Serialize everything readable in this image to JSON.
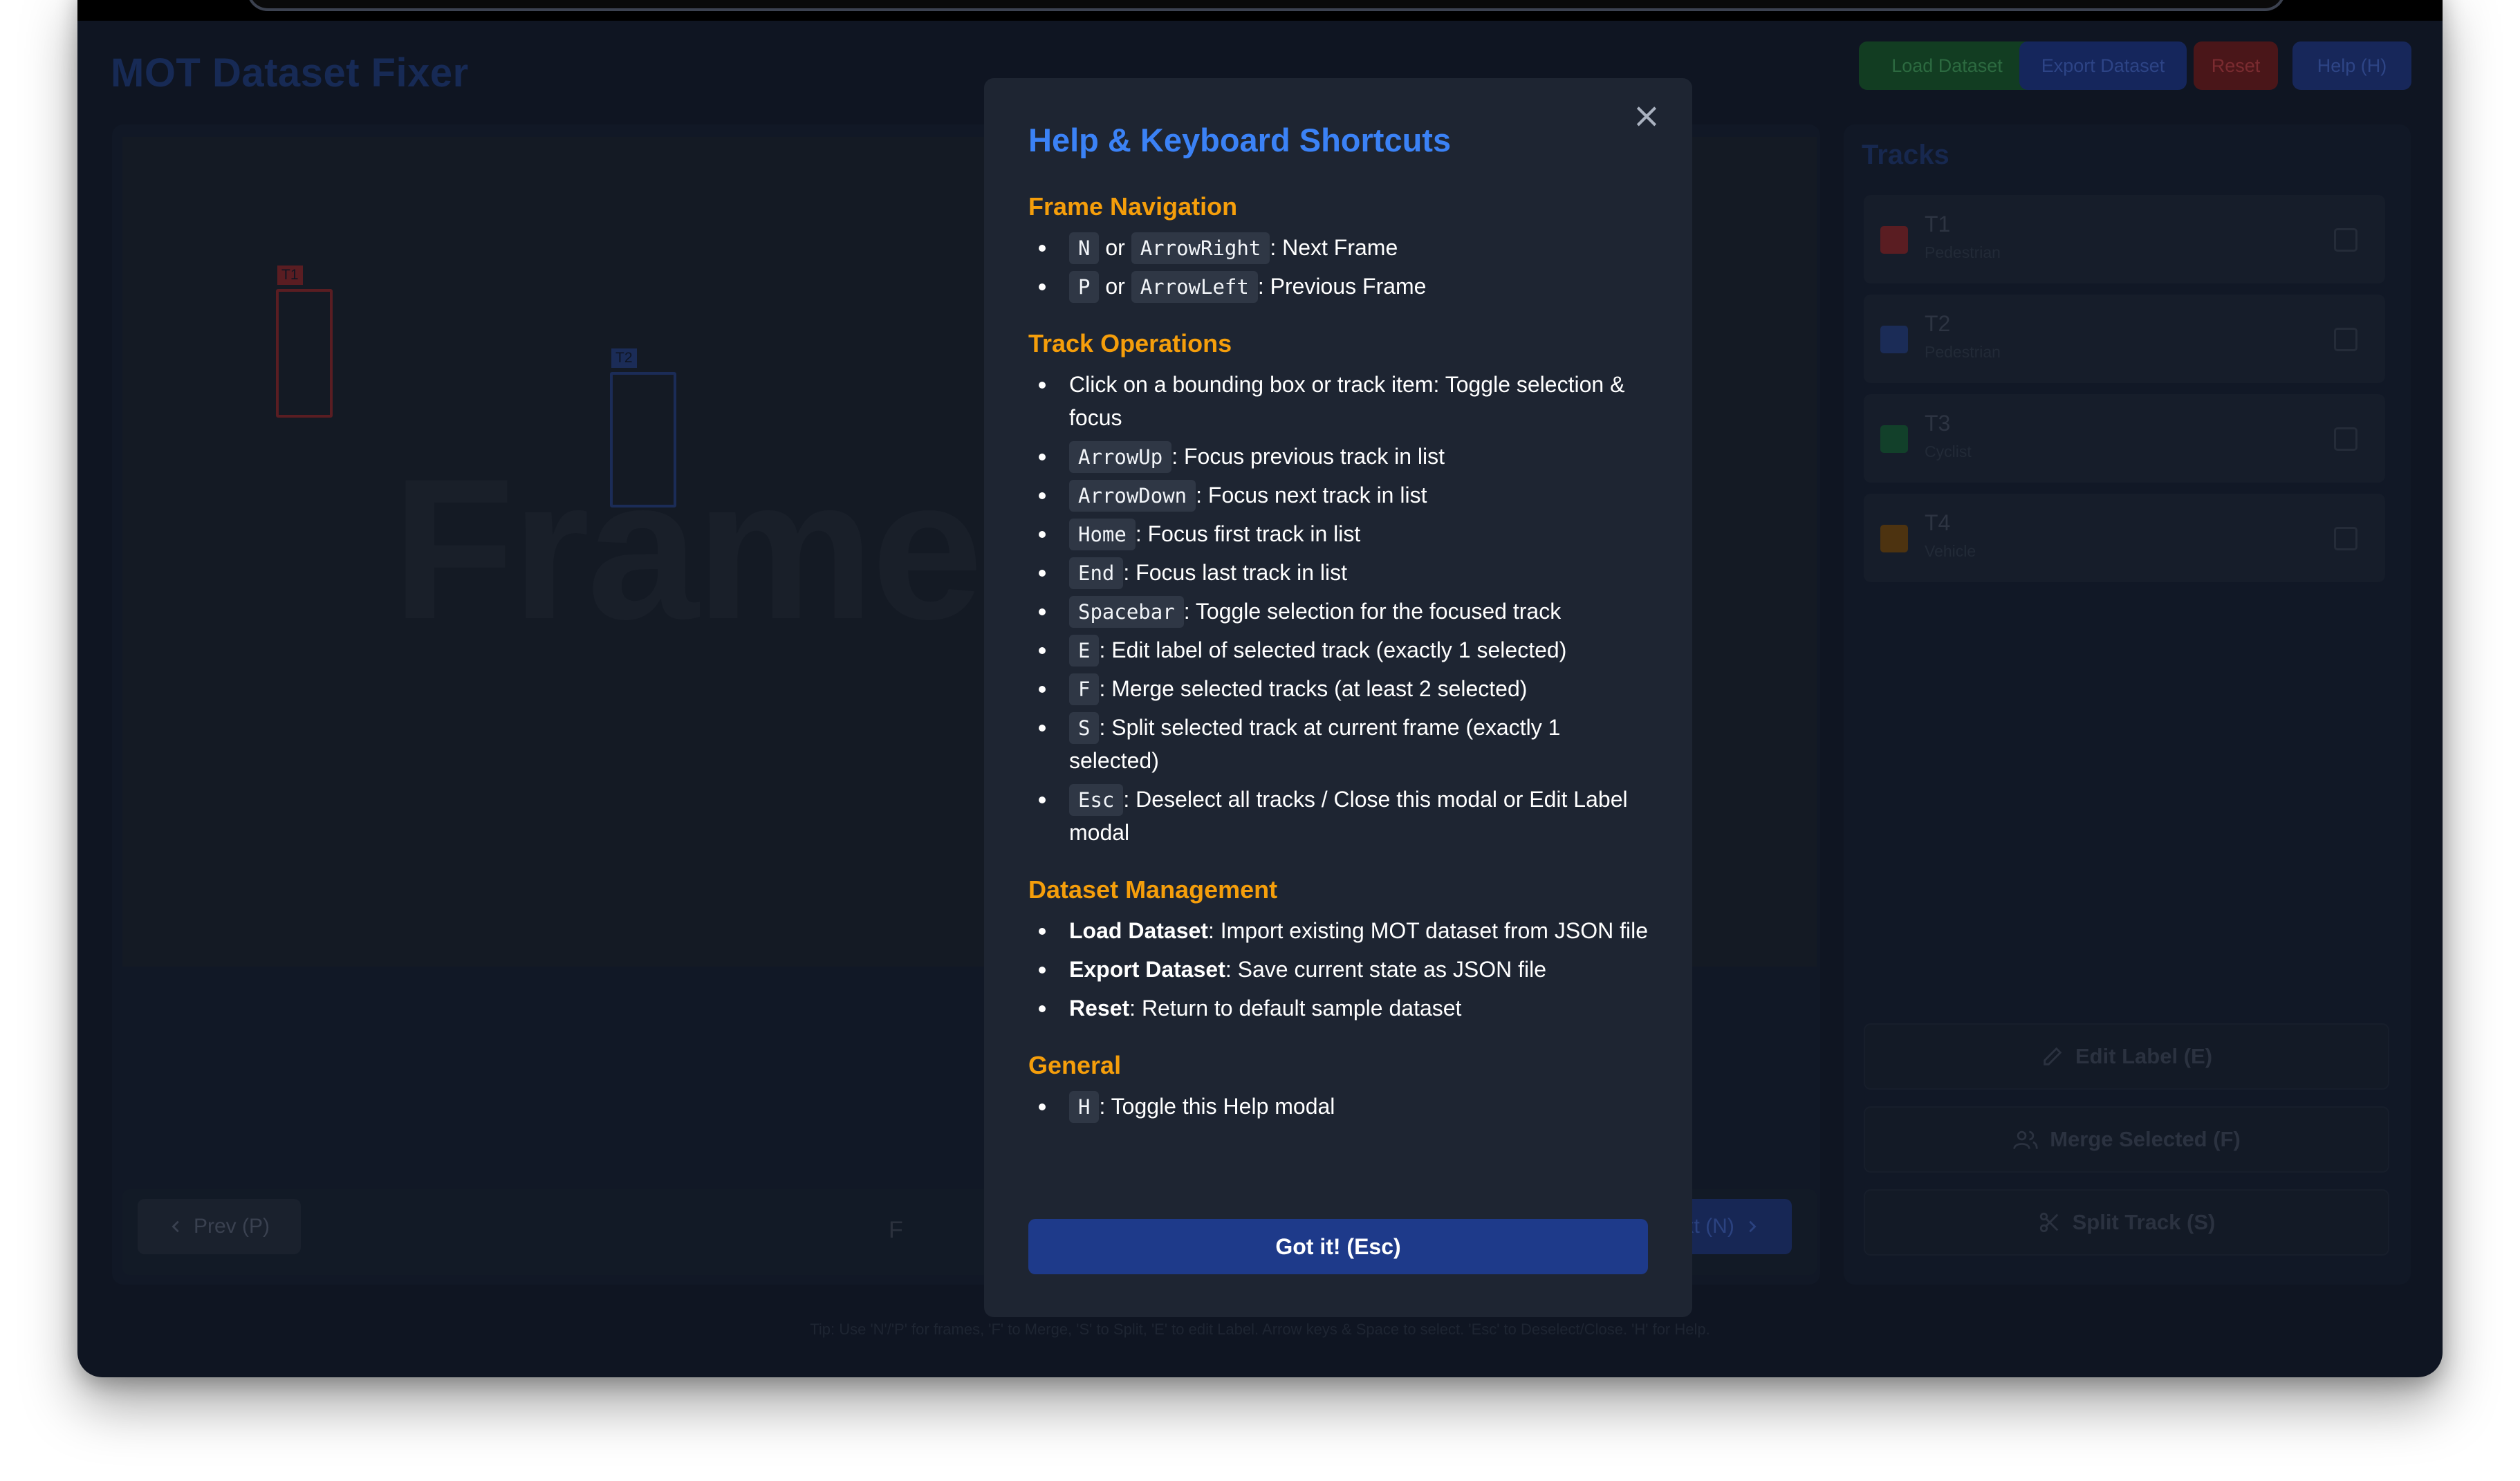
{
  "app": {
    "title": "MOT Dataset Fixer",
    "header_buttons": {
      "load": "Load Dataset",
      "export": "Export Dataset",
      "reset": "Reset",
      "help": "Help (H)"
    },
    "colors": {
      "load": "#16a34a",
      "export": "#2563eb",
      "reset": "#dc2626",
      "help": "#2563eb"
    }
  },
  "canvas": {
    "watermark": "Frame",
    "boxes": [
      {
        "label": "T1",
        "color": "#dc2626"
      },
      {
        "label": "T2",
        "color": "#2563eb"
      }
    ]
  },
  "navigation": {
    "prev_label": "Prev (P)",
    "next_label": "Next (N)",
    "frame_text": "F"
  },
  "tracks": {
    "title": "Tracks",
    "items": [
      {
        "id": "T1",
        "type": "Pedestrian",
        "color": "#dc2626"
      },
      {
        "id": "T2",
        "type": "Pedestrian",
        "color": "#2563eb"
      },
      {
        "id": "T3",
        "type": "Cyclist",
        "color": "#16a34a"
      },
      {
        "id": "T4",
        "type": "Vehicle",
        "color": "#d97706"
      }
    ],
    "actions": {
      "edit": "Edit Label (E)",
      "merge": "Merge Selected (F)",
      "split": "Split Track (S)"
    }
  },
  "tip": "Tip: Use 'N'/'P' for frames, 'F' to Merge, 'S' to Split, 'E' to edit Label. Arrow keys & Space to select. 'Esc' to Deselect/Close. 'H' for Help.",
  "modal": {
    "title": "Help & Keyboard Shortcuts",
    "close_symbol": "×",
    "sections": {
      "frame_nav": {
        "heading": "Frame Navigation",
        "items": [
          {
            "key1": "N",
            "or": "or",
            "key2": "ArrowRight",
            "desc": ": Next Frame"
          },
          {
            "key1": "P",
            "or": "or",
            "key2": "ArrowLeft",
            "desc": ": Previous Frame"
          }
        ]
      },
      "track_ops": {
        "heading": "Track Operations",
        "click_item": "Click on a bounding box or track item: Toggle selection & focus",
        "items": [
          {
            "key": "ArrowUp",
            "desc": ": Focus previous track in list"
          },
          {
            "key": "ArrowDown",
            "desc": ": Focus next track in list"
          },
          {
            "key": "Home",
            "desc": ": Focus first track in list"
          },
          {
            "key": "End",
            "desc": ": Focus last track in list"
          },
          {
            "key": "Spacebar",
            "desc": ": Toggle selection for the focused track"
          },
          {
            "key": "E",
            "desc": ": Edit label of selected track (exactly 1 selected)"
          },
          {
            "key": "F",
            "desc": ": Merge selected tracks (at least 2 selected)"
          },
          {
            "key": "S",
            "desc": ": Split selected track at current frame (exactly 1 selected)"
          },
          {
            "key": "Esc",
            "desc": ": Deselect all tracks / Close this modal or Edit Label modal"
          }
        ]
      },
      "dataset": {
        "heading": "Dataset Management",
        "items": [
          {
            "term": "Load Dataset",
            "desc": ": Import existing MOT dataset from JSON file"
          },
          {
            "term": "Export Dataset",
            "desc": ": Save current state as JSON file"
          },
          {
            "term": "Reset",
            "desc": ": Return to default sample dataset"
          }
        ]
      },
      "general": {
        "heading": "General",
        "items": [
          {
            "key": "H",
            "desc": ": Toggle this Help modal"
          }
        ]
      }
    },
    "button": "Got it! (Esc)"
  }
}
